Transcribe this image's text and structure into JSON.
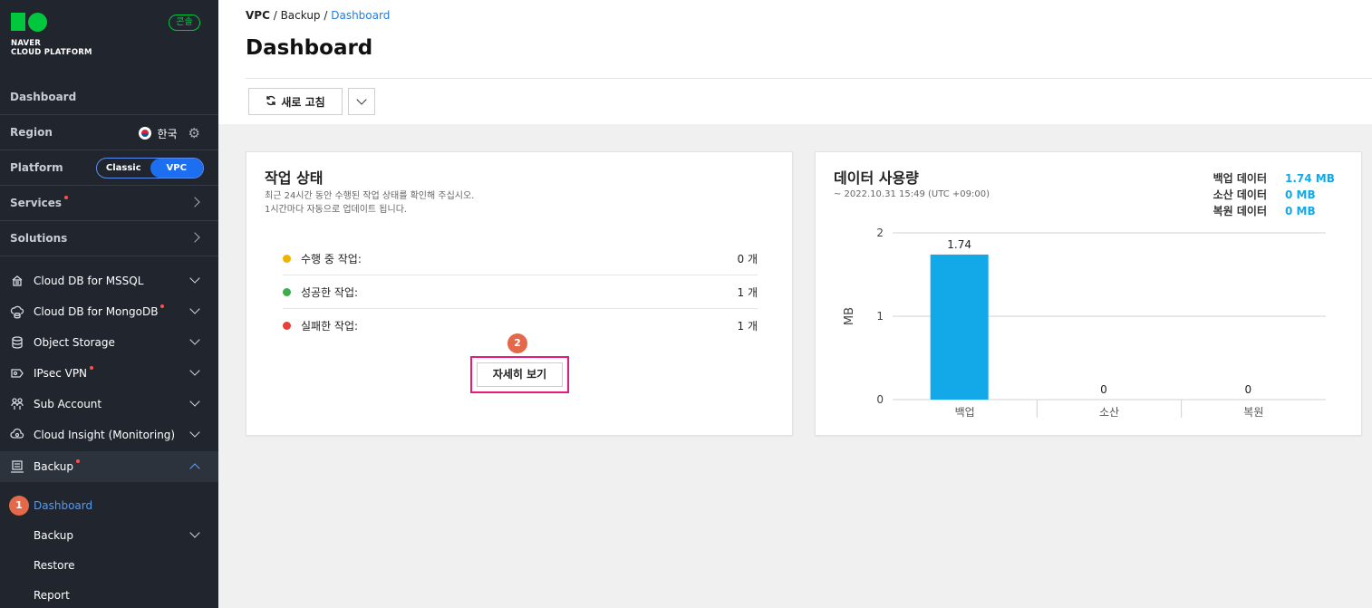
{
  "sidebar": {
    "logo_line1": "NAVER",
    "logo_line2": "CLOUD PLATFORM",
    "console_badge": "콘솔",
    "dashboard": "Dashboard",
    "region_label": "Region",
    "region_value": "한국",
    "platform_label": "Platform",
    "platform_options": [
      "Classic",
      "VPC"
    ],
    "platform_selected": "VPC",
    "services": "Services",
    "solutions": "Solutions",
    "items": [
      {
        "label": "Cloud DB for MSSQL",
        "icon": "database-cloud-icon",
        "dot": false
      },
      {
        "label": "Cloud DB for MongoDB",
        "icon": "mongodb-icon",
        "dot": true
      },
      {
        "label": "Object Storage",
        "icon": "storage-icon",
        "dot": false
      },
      {
        "label": "IPsec VPN",
        "icon": "vpn-icon",
        "dot": true
      },
      {
        "label": "Sub Account",
        "icon": "sub-account-icon",
        "dot": false
      },
      {
        "label": "Cloud Insight (Monitoring)",
        "icon": "monitoring-icon",
        "dot": false
      },
      {
        "label": "Backup",
        "icon": "backup-icon",
        "dot": true
      }
    ],
    "backup_sub": [
      "Dashboard",
      "Backup",
      "Restore",
      "Report"
    ],
    "step1": "1"
  },
  "breadcrumb": [
    "VPC",
    "Backup",
    "Dashboard"
  ],
  "page_title": "Dashboard",
  "toolbar": {
    "refresh_label": "새로 고침"
  },
  "job_status": {
    "title": "작업 상태",
    "desc_line1": "최근 24시간 동안 수행된 작업 상태를 확인해 주십시오.",
    "desc_line2": "1시간마다 자동으로 업데이트 됩니다.",
    "rows": [
      {
        "label": "수행 중 작업:",
        "value": "0 개",
        "color": "#f0b400"
      },
      {
        "label": "성공한 작업:",
        "value": "1 개",
        "color": "#3fae49"
      },
      {
        "label": "실패한 작업:",
        "value": "1 개",
        "color": "#e8403a"
      }
    ],
    "step2": "2",
    "detail_label": "자세히 보기"
  },
  "data_usage": {
    "title": "데이터 사용량",
    "date": "~ 2022.10.31 15:49 (UTC +09:00)",
    "legend": [
      {
        "label": "백업 데이터",
        "value": "1.74 MB"
      },
      {
        "label": "소산 데이터",
        "value": "0 MB"
      },
      {
        "label": "복원 데이터",
        "value": "0 MB"
      }
    ]
  },
  "chart_data": {
    "type": "bar",
    "categories": [
      "백업",
      "소산",
      "복원"
    ],
    "values": [
      1.74,
      0,
      0
    ],
    "data_labels": [
      "1.74",
      "0",
      "0"
    ],
    "ylabel": "MB",
    "ylim": [
      0,
      2
    ],
    "yticks": [
      "0",
      "1",
      "2"
    ],
    "bar_color": "#13a8e7",
    "grid": true
  }
}
